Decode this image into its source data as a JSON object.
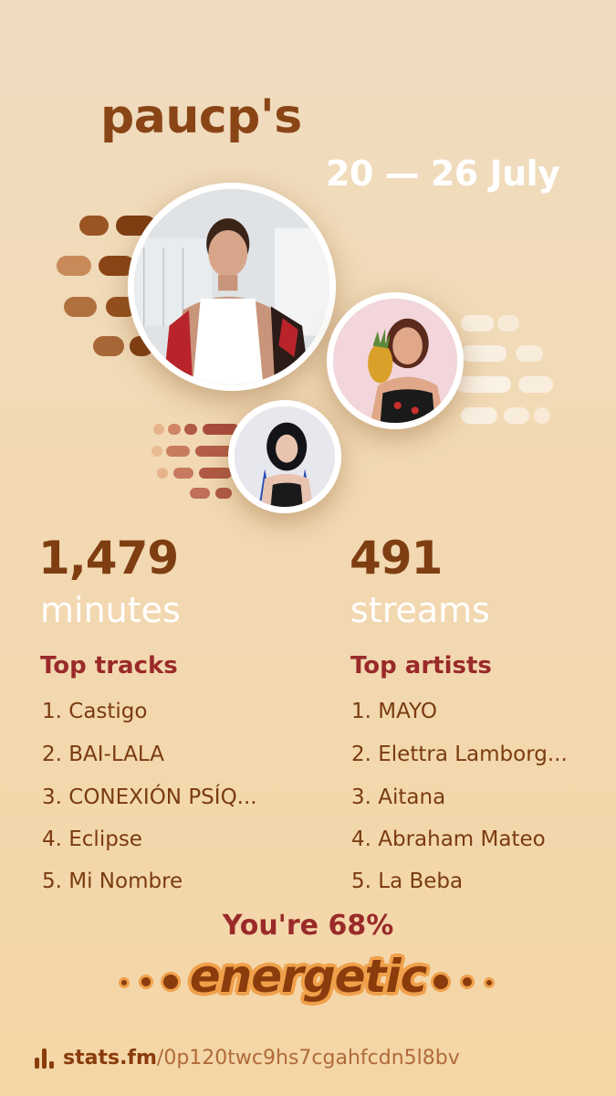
{
  "header": {
    "username": "paucp's",
    "date_range": "20 — 26 July"
  },
  "artists_images": [
    {
      "name": "MAYO",
      "icon": "artist-photo-1"
    },
    {
      "name": "Elettra Lamborghini",
      "icon": "artist-photo-2"
    },
    {
      "name": "Aitana",
      "icon": "artist-photo-3"
    }
  ],
  "stats": {
    "minutes_value": "1,479",
    "minutes_label": "minutes",
    "streams_value": "491",
    "streams_label": "streams"
  },
  "top_tracks": {
    "title": "Top tracks",
    "items": [
      "1. Castigo",
      "2. BAI-LALA",
      "3. CONEXIÓN PSÍQ...",
      "4. Eclipse",
      "5. Mi Nombre"
    ]
  },
  "top_artists": {
    "title": "Top artists",
    "items": [
      "1. MAYO",
      "2. Elettra Lamborg...",
      "3. Aitana",
      "4. Abraham Mateo",
      "5. La Beba"
    ]
  },
  "mood": {
    "line": "You're 68%",
    "word": "energetic"
  },
  "footer": {
    "brand": "stats.fm",
    "slug": "/0p120twc9hs7cgahfcdn5l8bv",
    "icon": "stats-bars-icon"
  },
  "colors": {
    "primary_brown": "#8a4516",
    "accent_red": "#9a2a2a",
    "highlight_orange": "#f0a04a",
    "background": "#f2d9b3"
  }
}
